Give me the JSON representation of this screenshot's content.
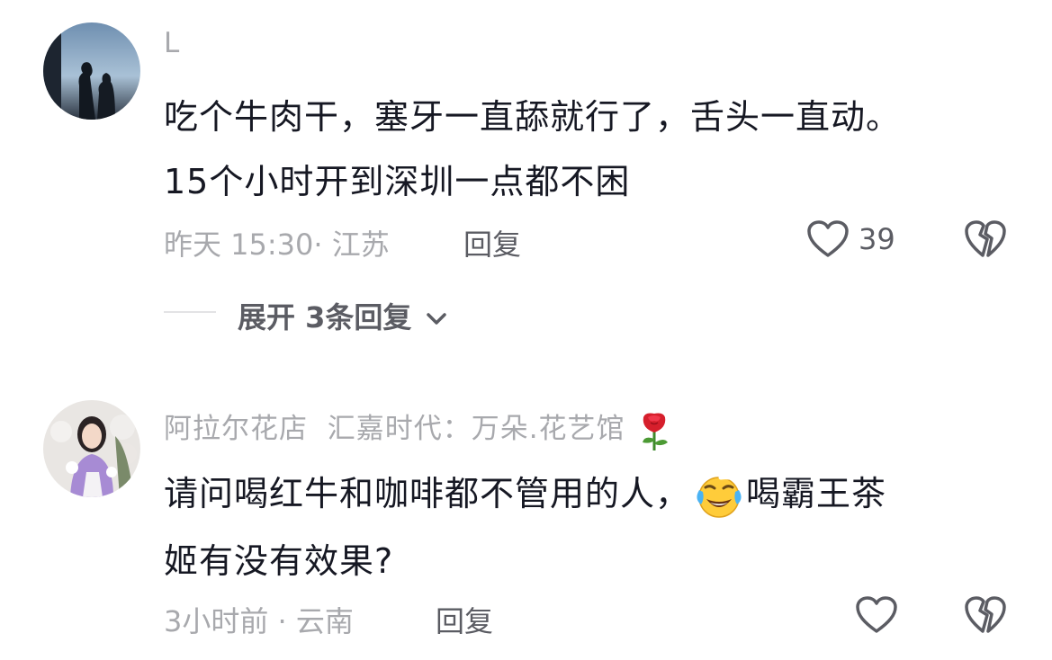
{
  "comments": [
    {
      "username": "L",
      "text_lines": [
        "吃个牛肉干，塞牙一直舔就行了，舌头一直动。",
        "15个小时开到深圳一点都不困"
      ],
      "time_location": "昨天 15:30· 江苏",
      "reply_label": "回复",
      "like_count": "39",
      "expand_label": "展开 3条回复"
    },
    {
      "username": "阿拉尔花店  汇嘉时代：万朵.花艺馆",
      "text_line1_a": "请问喝红牛和咖啡都不管用的人，",
      "text_line1_b": "喝霸王茶",
      "text_line2": "姬有没有效果?",
      "time_location": "3小时前 · 云南",
      "reply_label": "回复"
    }
  ],
  "icons": {
    "like": "heart-outline-icon",
    "dislike": "broken-heart-icon",
    "expand": "chevron-down-icon",
    "rose": "rose-emoji",
    "laugh": "rolling-laugh-emoji"
  },
  "colors": {
    "text": "#161823",
    "muted": "#a8a9ad",
    "action": "#5b5c63"
  }
}
